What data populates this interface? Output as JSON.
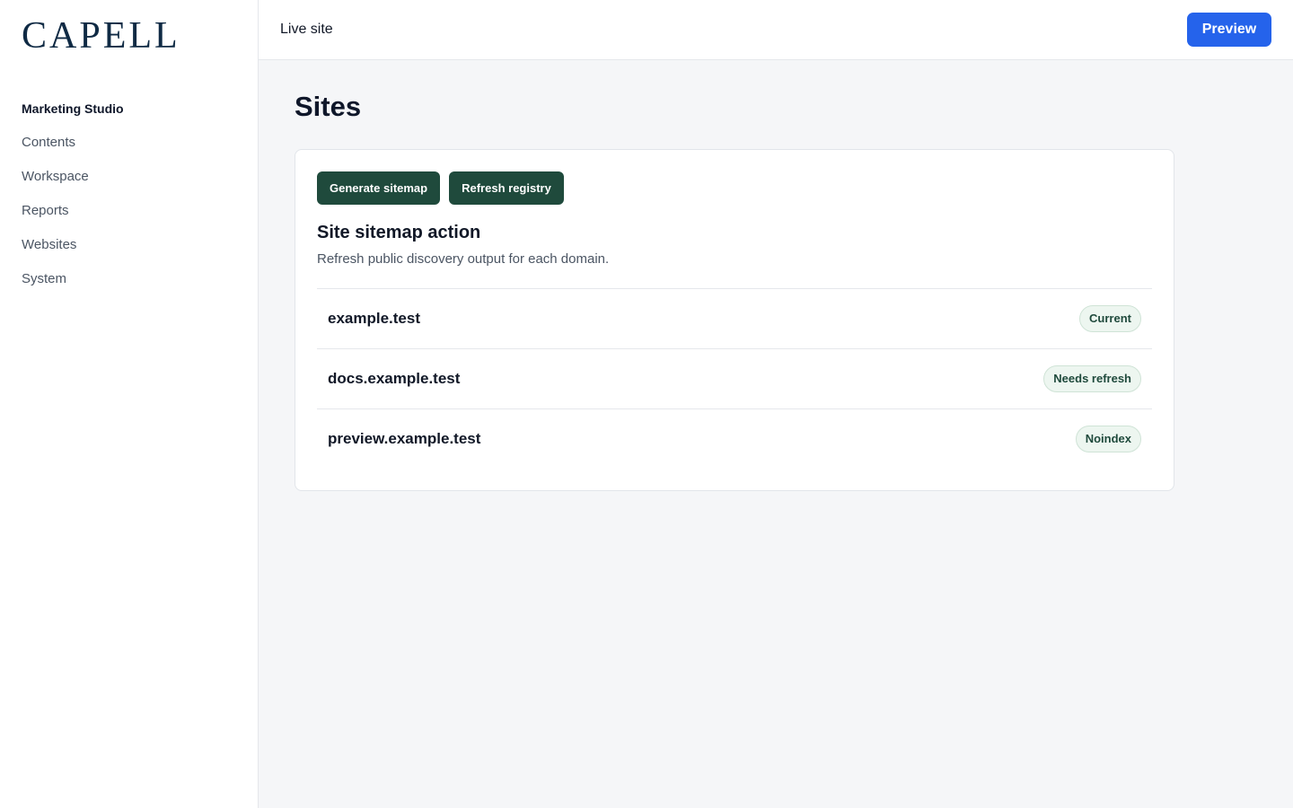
{
  "sidebar": {
    "logo": "CAPELL",
    "items": [
      {
        "label": "Marketing Studio",
        "active": true
      },
      {
        "label": "Contents",
        "active": false
      },
      {
        "label": "Workspace",
        "active": false
      },
      {
        "label": "Reports",
        "active": false
      },
      {
        "label": "Websites",
        "active": false
      },
      {
        "label": "System",
        "active": false
      }
    ]
  },
  "topbar": {
    "title": "Live site",
    "preview_label": "Preview"
  },
  "page": {
    "title": "Sites"
  },
  "card": {
    "actions": [
      {
        "label": "Generate sitemap"
      },
      {
        "label": "Refresh registry"
      }
    ],
    "section_title": "Site sitemap action",
    "section_desc": "Refresh public discovery output for each domain.",
    "sites": [
      {
        "name": "example.test",
        "status": "Current"
      },
      {
        "name": "docs.example.test",
        "status": "Needs refresh"
      },
      {
        "name": "preview.example.test",
        "status": "Noindex"
      }
    ]
  },
  "colors": {
    "primary": "#2563eb",
    "action": "#1f4a3c",
    "badge_bg": "#edf6f0",
    "logo": "#0f2a44"
  }
}
